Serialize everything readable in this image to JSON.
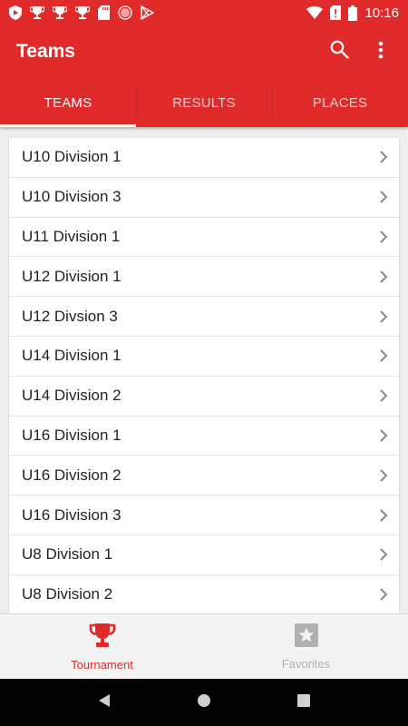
{
  "status_bar": {
    "time": "10:16",
    "icons": [
      "shield-notification-icon",
      "trophy-notification-icon",
      "trophy-notification-icon",
      "trophy-notification-icon",
      "sd-card-icon",
      "record-icon",
      "play-store-icon",
      "wifi-icon",
      "no-sim-icon",
      "battery-icon"
    ]
  },
  "app_bar": {
    "title": "Teams",
    "search_icon": "search-icon",
    "menu_icon": "more-vert-icon"
  },
  "tabs": [
    {
      "label": "TEAMS",
      "active": true
    },
    {
      "label": "RESULTS",
      "active": false
    },
    {
      "label": "PLACES",
      "active": false
    }
  ],
  "teams": [
    {
      "label": "U10 Division 1"
    },
    {
      "label": "U10 Division 3"
    },
    {
      "label": "U11 Division 1"
    },
    {
      "label": "U12 Division 1"
    },
    {
      "label": "U12 Divsion 3"
    },
    {
      "label": "U14 Division 1"
    },
    {
      "label": "U14 Division 2"
    },
    {
      "label": "U16 Division 1"
    },
    {
      "label": "U16 Division 2"
    },
    {
      "label": "U16 Division 3"
    },
    {
      "label": "U8 Division 1"
    },
    {
      "label": "U8 Division 2"
    }
  ],
  "bottom_nav": [
    {
      "label": "Tournament",
      "icon": "trophy-icon",
      "active": true
    },
    {
      "label": "Favorites",
      "icon": "star-icon",
      "active": false
    }
  ],
  "colors": {
    "primary": "#e12a2a",
    "inactive": "#b0b0b0"
  }
}
